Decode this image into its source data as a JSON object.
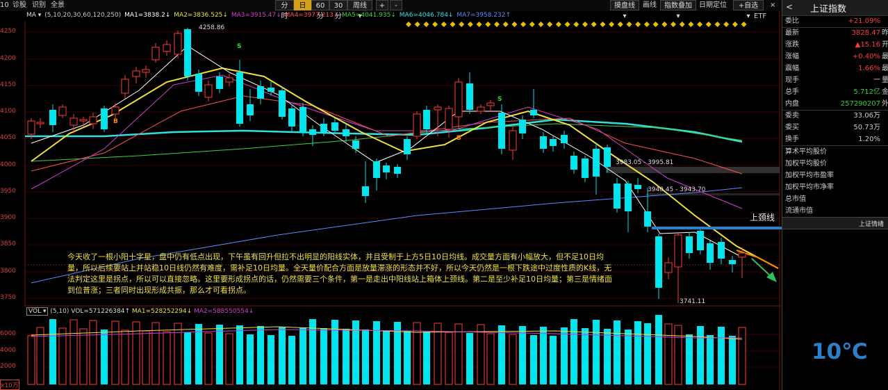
{
  "toolbar": {
    "left_items": [
      "10",
      "诊股",
      "识别",
      "全景"
    ],
    "periods": [
      "分时",
      "日线",
      "60分",
      "30分",
      "周线 ▾"
    ],
    "zoom_in": "+",
    "zoom_out": "-",
    "right_items": [
      "摸盘线 ▾",
      "画线",
      "指数叠加 ▾",
      "日期定位",
      "+自选 ▾",
      "×"
    ],
    "etf": "ETF"
  },
  "ma_legend": {
    "label": "MA ▾",
    "params": "(5,10,20,30,60,120,250)",
    "items": [
      {
        "text": "MA1=3838.2↓",
        "color": "#ffffff"
      },
      {
        "text": "MA2=3836.525↓",
        "color": "#f0e040"
      },
      {
        "text": "MA3=3915.47↓",
        "color": "#d040d0"
      },
      {
        "text": "MA4=3977.213↓",
        "color": "#ff5050"
      },
      {
        "text": "MA5=4041.935↓",
        "color": "#40d040"
      },
      {
        "text": "MA6=4046.784↓",
        "color": "#30e0e0"
      },
      {
        "text": "MA7=3958.232↑",
        "color": "#5a8cff"
      }
    ]
  },
  "price_axis": [
    "4250",
    "4200",
    "4150",
    "4100",
    "4050",
    "4000",
    "3950",
    "3900",
    "3850",
    "3800",
    "3750"
  ],
  "vol_axis": [
    "6000",
    "4000",
    "2000",
    "x10万"
  ],
  "vol_legend": {
    "label": "VOL ▾",
    "params": "(5,10)",
    "vol": "VOL=571226384↑",
    "ma1": "MA1=528252294↓",
    "ma2": "MA2=588550554↓"
  },
  "annotations": {
    "high": "4258.86",
    "low": "3741.11",
    "band1": "3983.05 - 3995.81",
    "band2": "3940.45 - 3943.70",
    "neckline": "上颈线",
    "s_mark": "S",
    "b_mark": "B"
  },
  "note": "今天收了一根小阳十字星，盘中仍有低点出现，下午虽有回升但拉不出明显的阳线实体，并且受制于上方5日10日均线。成交量方面有小幅放大，但不足10日均量，所以后续要站上并站稳10日线仍然有难度，需补足10日均量。全天量价配合方面是放量滞涨的形态并不好，所以今天仍然是一根下跌途中过度性质的K线，无法判定这里是拐点，所以可以直接忽略。这里要形成拐点的话，仍然需要三个条件，第一是走出中阳线站上箱体上颈线。第二是至少补足10日均量；第三是情绪面到位普涨；三者同时出现形成共振，那么才可看拐点。",
  "panel": {
    "back": "<",
    "title": "上证指数",
    "quote_rows": [
      {
        "label": "委比",
        "value": "+21.09%",
        "extra": "",
        "tone": "red"
      },
      {
        "label": "最新",
        "value": "3828.47",
        "extra": "昨",
        "tone": "red"
      },
      {
        "label": "涨跌",
        "value": "▲15.16",
        "extra": "开",
        "tone": "red"
      },
      {
        "label": "涨幅",
        "value": "+0.40%",
        "extra": "最",
        "tone": "red"
      },
      {
        "label": "震幅",
        "value": "1.66%",
        "extra": "最",
        "tone": "red"
      },
      {
        "label": "现手",
        "value": "一",
        "extra": "量",
        "tone": "plain"
      },
      {
        "label": "总手",
        "value": "5.712亿",
        "extra": "金",
        "tone": "green"
      },
      {
        "label": "内盘",
        "value": "257290207",
        "extra": "外",
        "tone": "green"
      },
      {
        "label": "委卖",
        "value": "33.06万",
        "extra": "",
        "tone": "plain"
      },
      {
        "label": "委买",
        "value": "50.73万",
        "extra": "",
        "tone": "plain"
      },
      {
        "label": "换手",
        "value": "1.20%",
        "extra": "",
        "tone": "plain"
      }
    ],
    "info_rows": [
      "算术平均股价",
      "加权平均股价",
      "加权平均市盈率",
      "加权平均市净率",
      "总市值",
      "流通市值"
    ],
    "sub_title": "上证情绪"
  },
  "temperature": "10℃",
  "colors": {
    "up": "#ff3b3b",
    "down": "#00e5ee",
    "neckline": "#2d7fc8"
  }
}
